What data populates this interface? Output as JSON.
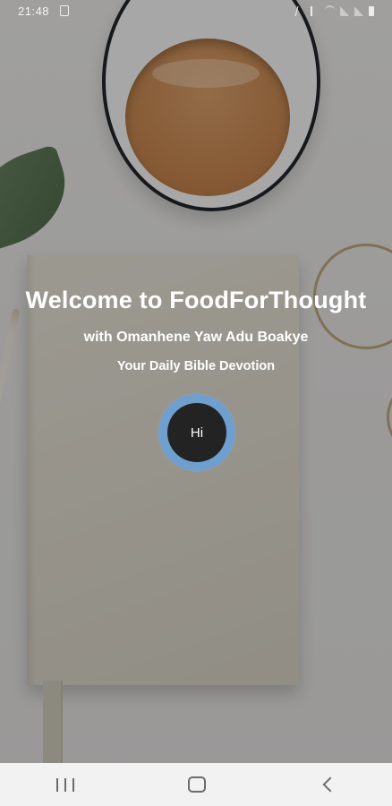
{
  "status_bar": {
    "time": "21:48",
    "icons": [
      "notification-icon",
      "bluetooth-icon",
      "mute-icon",
      "wifi-icon",
      "signal-icon",
      "signal-icon",
      "battery-icon"
    ]
  },
  "welcome": {
    "title": "Welcome to FoodForThought",
    "subtitle": "with Omanhene Yaw Adu Boakye",
    "tagline": "Your Daily Bible Devotion"
  },
  "hi_button": {
    "label": "Hi",
    "ring_color": "#6f9fcf",
    "fill_color": "#232323"
  },
  "nav_bar": {
    "icons": [
      "recent-apps-icon",
      "home-icon",
      "back-icon"
    ]
  }
}
